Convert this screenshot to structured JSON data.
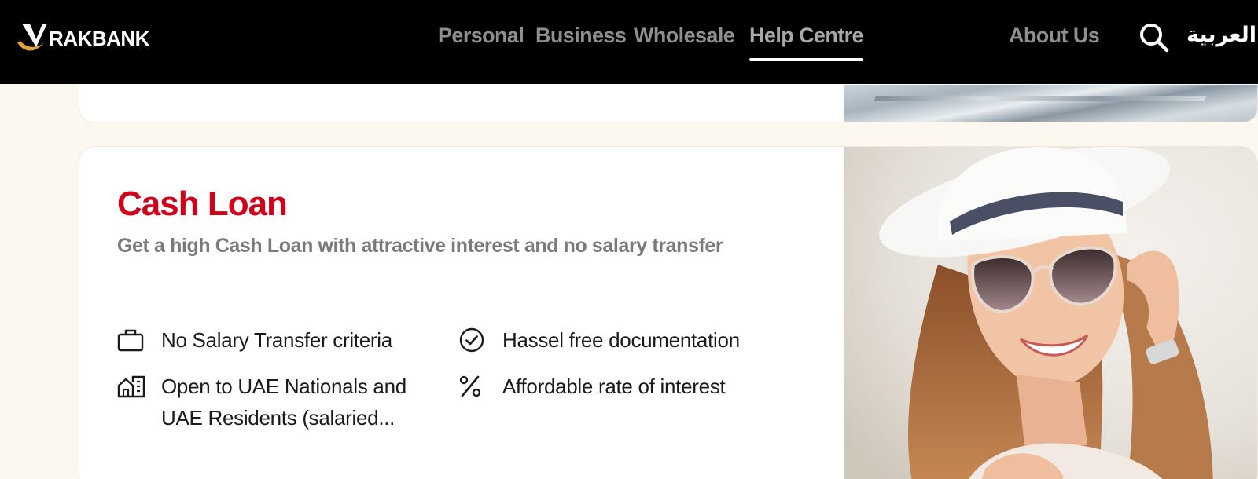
{
  "header": {
    "logo_text": "RAKBANK",
    "nav": [
      {
        "label": "Personal"
      },
      {
        "label": "Business"
      },
      {
        "label": "Wholesale"
      },
      {
        "label": "Help Centre",
        "active": true
      }
    ],
    "about_label": "About Us",
    "search_icon": "search-icon",
    "language_label": "العربية"
  },
  "card": {
    "title": "Cash Loan",
    "subtitle": "Get a high Cash Loan with attractive interest and no salary transfer",
    "features": [
      {
        "icon": "briefcase-icon",
        "text": "No Salary Transfer criteria"
      },
      {
        "icon": "check-circle-icon",
        "text": "Hassel free documentation"
      },
      {
        "icon": "buildings-icon",
        "text": "Open to UAE Nationals and UAE Residents (salaried..."
      },
      {
        "icon": "percent-icon",
        "text": "Affordable rate of interest"
      }
    ]
  },
  "colors": {
    "brand_red": "#d0021b",
    "header_bg": "#000000",
    "page_bg": "#fdf8ef"
  }
}
